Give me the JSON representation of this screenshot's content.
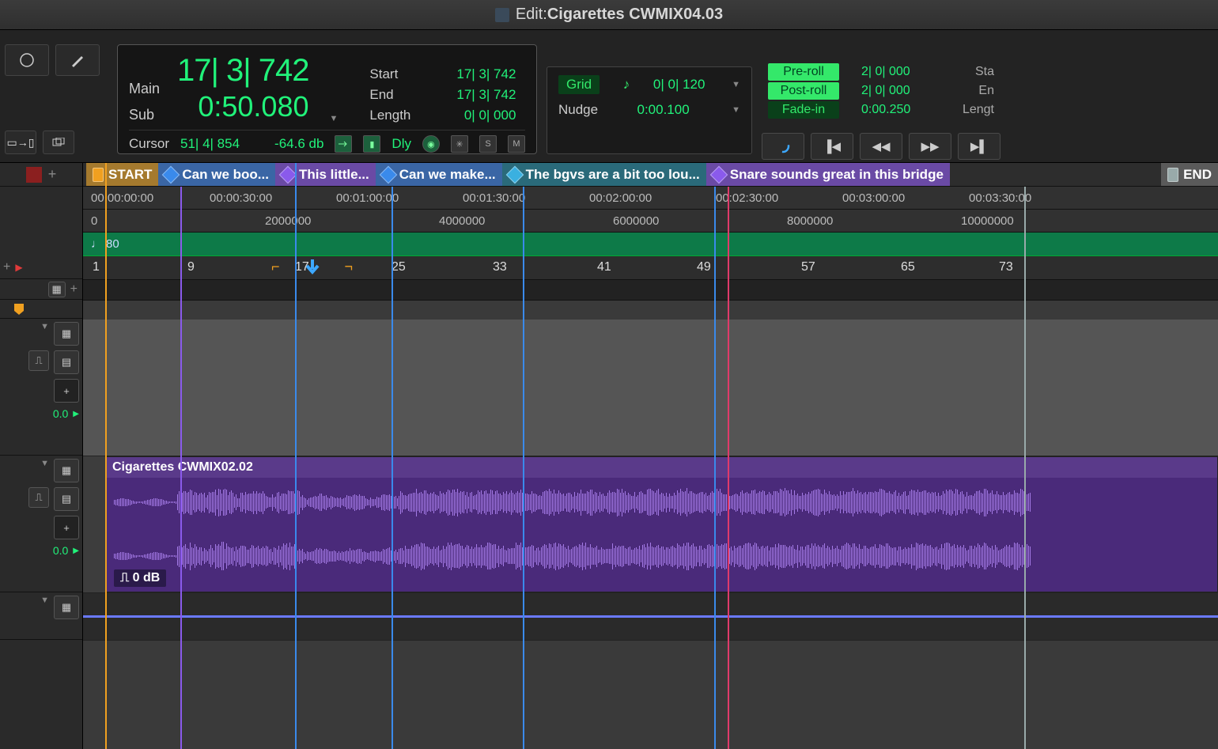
{
  "title": {
    "prefix": "Edit: ",
    "name": "Cigarettes CWMIX04.03"
  },
  "counter": {
    "mainLabel": "Main",
    "subLabel": "Sub",
    "mainValue": "17| 3| 742",
    "subValue": "0:50.080",
    "startLabel": "Start",
    "endLabel": "End",
    "lengthLabel": "Length",
    "startValue": "17| 3| 742",
    "endValue": "17| 3| 742",
    "lengthValue": "0| 0| 000",
    "cursorLabel": "Cursor",
    "cursorPos": "51| 4| 854",
    "cursorDb": "-64.6 db",
    "dly": "Dly",
    "flags": {
      "s": "S",
      "m": "M"
    }
  },
  "grid": {
    "label": "Grid",
    "value": "0| 0| 120",
    "nudgeLabel": "Nudge",
    "nudgeValue": "0:00.100"
  },
  "roll": {
    "pre": "Pre-roll",
    "post": "Post-roll",
    "fade": "Fade-in",
    "preV": "2| 0| 000",
    "postV": "2| 0| 000",
    "fadeV": "0:00.250",
    "rLabels": [
      "Sta",
      "En",
      "Lengt"
    ]
  },
  "markers": [
    {
      "style": "orange",
      "text": "START"
    },
    {
      "style": "blue",
      "text": "Can we boo..."
    },
    {
      "style": "purple",
      "text": "This little..."
    },
    {
      "style": "blue",
      "text": "Can we make..."
    },
    {
      "style": "teal",
      "text": "The bgvs are a bit too lou..."
    },
    {
      "style": "purple",
      "text": "Snare sounds great in this bridge"
    },
    {
      "style": "gray",
      "text": "END"
    }
  ],
  "timecodes": [
    "00:00:00:00",
    "00:00:30:00",
    "00:01:00:00",
    "00:01:30:00",
    "00:02:00:00",
    "00:02:30:00",
    "00:03:00:00",
    "00:03:30:00"
  ],
  "samples": [
    "0",
    "2000000",
    "4000000",
    "6000000",
    "8000000",
    "10000000"
  ],
  "tempo": "80",
  "bars": [
    "1",
    "9",
    "17",
    "25",
    "33",
    "41",
    "49",
    "57",
    "65",
    "73"
  ],
  "clip": {
    "name": "Cigarettes CWMIX02.02",
    "db": "0 dB"
  },
  "trackValue": "0.0",
  "plusIcon": "+"
}
